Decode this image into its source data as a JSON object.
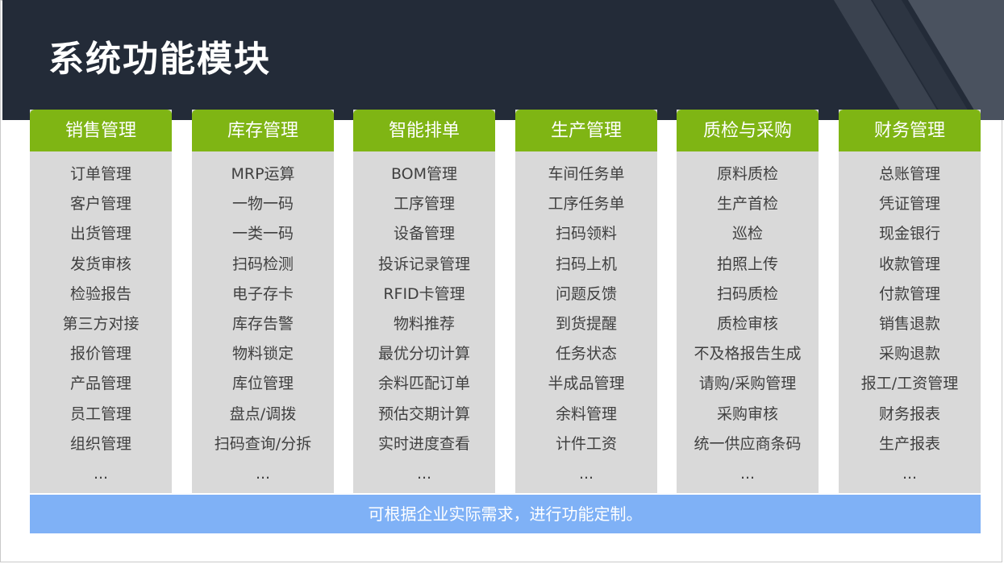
{
  "title": "系统功能模块",
  "columns": [
    {
      "header": "销售管理",
      "items": [
        "订单管理",
        "客户管理",
        "出货管理",
        "发货审核",
        "检验报告",
        "第三方对接",
        "报价管理",
        "产品管理",
        "员工管理",
        "组织管理",
        "..."
      ]
    },
    {
      "header": "库存管理",
      "items": [
        "MRP运算",
        "一物一码",
        "一类一码",
        "扫码检测",
        "电子存卡",
        "库存告警",
        "物料锁定",
        "库位管理",
        "盘点/调拨",
        "扫码查询/分拆",
        "..."
      ]
    },
    {
      "header": "智能排单",
      "items": [
        "BOM管理",
        "工序管理",
        "设备管理",
        "投诉记录管理",
        "RFID卡管理",
        "物料推荐",
        "最优分切计算",
        "余料匹配订单",
        "预估交期计算",
        "实时进度查看",
        "..."
      ]
    },
    {
      "header": "生产管理",
      "items": [
        "车间任务单",
        "工序任务单",
        "扫码领料",
        "扫码上机",
        "问题反馈",
        "到货提醒",
        "任务状态",
        "半成品管理",
        "余料管理",
        "计件工资",
        "..."
      ]
    },
    {
      "header": "质检与采购",
      "items": [
        "原料质检",
        "生产首检",
        "巡检",
        "拍照上传",
        "扫码质检",
        "质检审核",
        "不及格报告生成",
        "请购/采购管理",
        "采购审核",
        "统一供应商条码",
        "..."
      ]
    },
    {
      "header": "财务管理",
      "items": [
        "总账管理",
        "凭证管理",
        "现金银行",
        "收款管理",
        "付款管理",
        "销售退款",
        "采购退款",
        "报工/工资管理",
        "财务报表",
        "生产报表",
        "..."
      ]
    }
  ],
  "footer": "可根据企业实际需求，进行功能定制。",
  "colors": {
    "header_bg": "#232b38",
    "column_head": "#7fb514",
    "column_body": "#d9d9d9",
    "footer_bar": "#7fb1f6"
  }
}
